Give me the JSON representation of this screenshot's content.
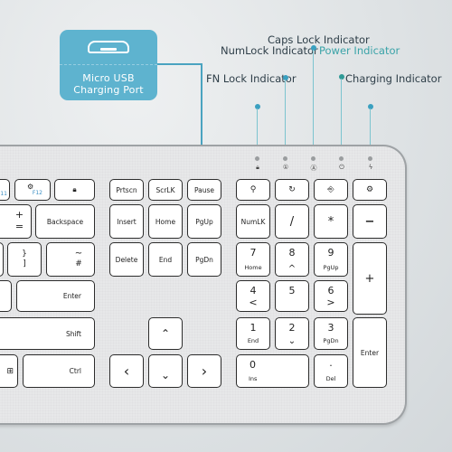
{
  "callout": {
    "icon": "micro-usb-port-icon",
    "label_line1": "Micro USB",
    "label_line2": "Charging Port"
  },
  "indicators": [
    {
      "label": "FN Lock Indicator",
      "icon": "lock-icon",
      "glyph": "🔒︎",
      "color": "#2e3e48"
    },
    {
      "label": "NumLock Indicator",
      "icon": "numlock-icon",
      "glyph": "①",
      "color": "#2e3e48"
    },
    {
      "label": "Caps Lock Indicator",
      "icon": "capslock-icon",
      "glyph": "Ⓐ",
      "color": "#2e3e48"
    },
    {
      "label": "Power Indicator",
      "icon": "power-icon",
      "glyph": "⏻",
      "color": "#3aa3a8"
    },
    {
      "label": "Charging Indicator",
      "icon": "charging-bolt-icon",
      "glyph": "ϟ",
      "color": "#2e3e48"
    }
  ],
  "keys": {
    "f11": "11",
    "f12": "F12",
    "f12_icon": "⚙",
    "lock_glyph": "🔒︎",
    "prtscn": "Prtscn",
    "scrlk": "ScrLK",
    "pause": "Pause",
    "plus": "+",
    "equals": "=",
    "backspace": "Backspace",
    "insert": "Insert",
    "home": "Home",
    "pgup": "PgUp",
    "brace": "}",
    "bracket": "]",
    "tilde": "~",
    "hash": "#",
    "delete": "Delete",
    "end": "End",
    "pgdn": "PgDn",
    "enter": "Enter",
    "shift": "Shift",
    "ctrl": "Ctrl",
    "arrow_up": "⌃",
    "arrow_left": "‹",
    "arrow_down": "⌄",
    "arrow_right": "›",
    "search_glyph": "⚲",
    "refresh_glyph": "↻",
    "switch_glyph": "⎆",
    "settings_glyph": "⚙",
    "numlk": "NumLK",
    "slash": "/",
    "asterisk": "*",
    "minus": "−",
    "num7": "7",
    "num7_sub": "Home",
    "num8": "8",
    "num8_sub": "^",
    "num9": "9",
    "num9_sub": "PgUp",
    "num_plus": "+",
    "num4": "4",
    "num4_sub": "<",
    "num5": "5",
    "num5_sub": "",
    "num6": "6",
    "num6_sub": ">",
    "num1": "1",
    "num1_sub": "End",
    "num2": "2",
    "num2_sub": "⌄",
    "num3": "3",
    "num3_sub": "PgDn",
    "num_enter": "Enter",
    "num0": "0",
    "num0_sub": "Ins",
    "num_dot": ".",
    "num_dot_sub": "Del",
    "win_glyph": "⊞"
  }
}
